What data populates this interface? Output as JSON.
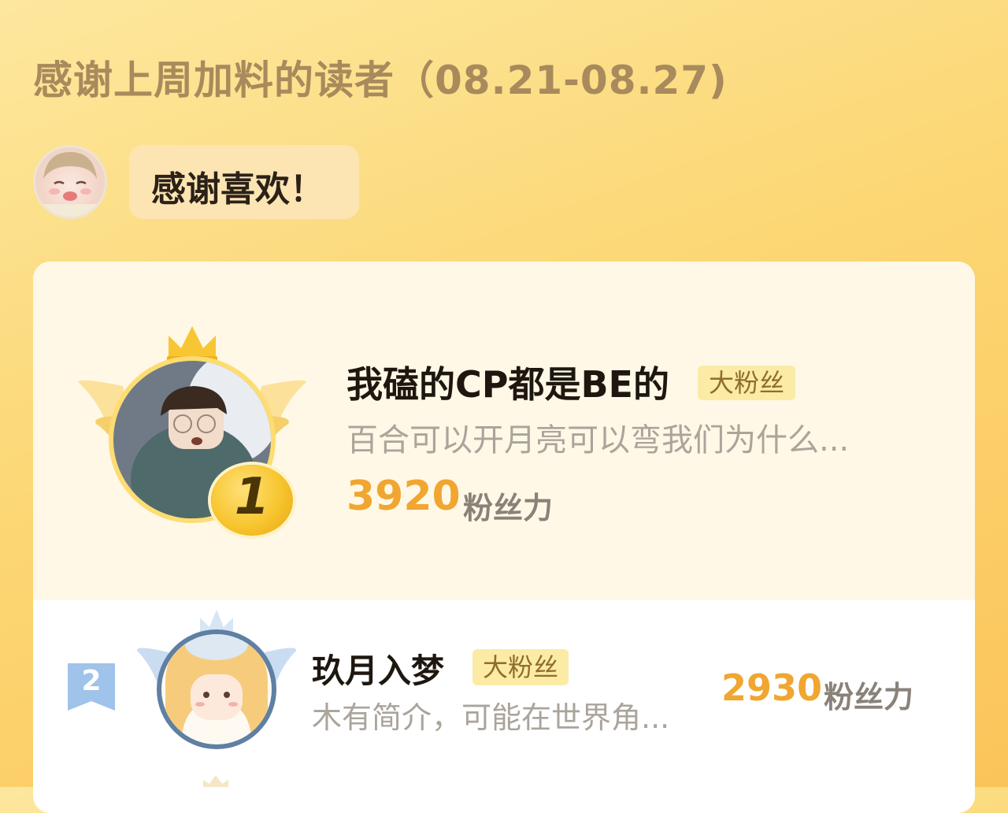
{
  "page_title": "感谢上周加料的读者（08.21-08.27)",
  "mascot": {
    "icon": "author-avatar-icon"
  },
  "bubble": {
    "text": "感谢喜欢！"
  },
  "ranking": [
    {
      "rank": "1",
      "name": "我磕的CP都是BE的",
      "badge": "大粉丝",
      "bio": "百合可以开月亮可以弯我们为什么...",
      "score": "3920",
      "unit": "粉丝力"
    },
    {
      "rank": "2",
      "name": "玖月入梦",
      "badge": "大粉丝",
      "bio": "木有简介，可能在世界角...",
      "score": "2930",
      "unit": "粉丝力"
    }
  ],
  "colors": {
    "accent_score": "#f0a630",
    "badge_bg": "#fbeba5",
    "gold_medal": "#f7c52e",
    "silver_flag": "#9fc3ea"
  }
}
